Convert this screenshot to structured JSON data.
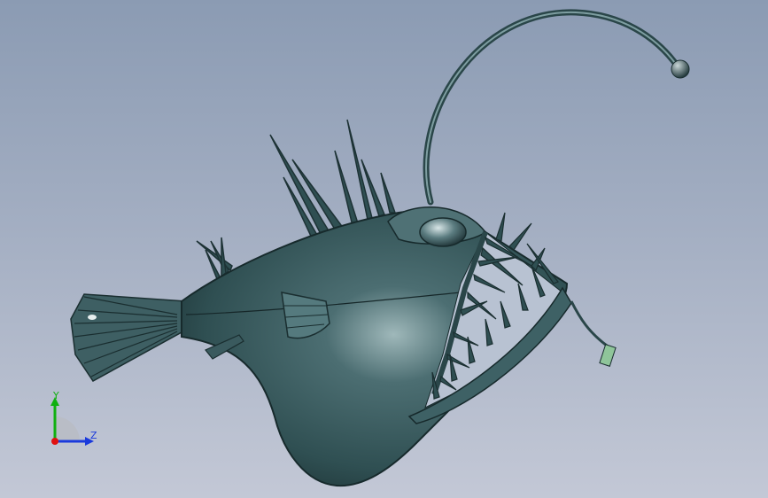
{
  "viewport": {
    "model": "anglerfish-3d-model"
  },
  "triad": {
    "y_label": "Y",
    "z_label": "Z",
    "colors": {
      "y": "#10b010",
      "z": "#1a3adc",
      "x": "#e01010"
    }
  },
  "model_colors": {
    "body": "#2f4f52",
    "highlight": "#9fb8ba",
    "shadow": "#1a2e30",
    "tag": "#8fc59a"
  }
}
